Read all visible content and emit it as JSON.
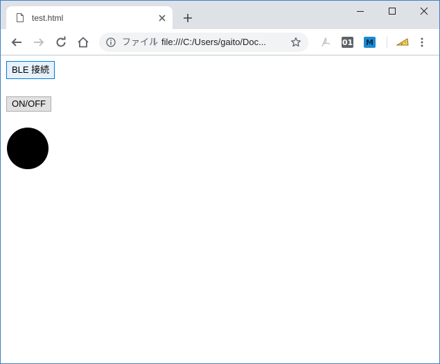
{
  "browser": {
    "tab": {
      "title": "test.html"
    },
    "omnibox": {
      "label": "ファイル",
      "separator": "|",
      "url": "file:///C:/Users/gaito/Doc..."
    },
    "extensions": {
      "ext_01_label": "01",
      "ext_m_label": "M"
    },
    "colors": {
      "tab_strip": "#dee1e6",
      "omnibox_bg": "#f1f3f4",
      "window_border": "#3c82c7"
    }
  },
  "page": {
    "ble_button": {
      "label": "BLE 接続"
    },
    "onoff_button": {
      "label": "ON/OFF"
    },
    "indicator": {
      "color": "#000000"
    }
  },
  "icons": {
    "favicon": "page-icon",
    "close": "close-icon",
    "new_tab": "plus-icon",
    "back": "arrow-left-icon",
    "forward": "arrow-right-icon",
    "reload": "reload-icon",
    "home": "home-icon",
    "info": "info-icon",
    "star": "star-icon",
    "menu": "kebab-menu-icon"
  }
}
